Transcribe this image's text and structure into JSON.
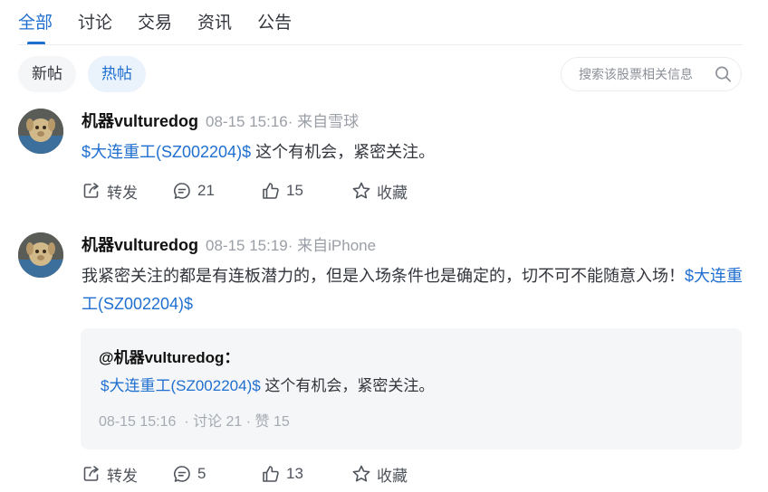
{
  "tabs": [
    {
      "label": "全部"
    },
    {
      "label": "讨论"
    },
    {
      "label": "交易"
    },
    {
      "label": "资讯"
    },
    {
      "label": "公告"
    }
  ],
  "filters": {
    "new": "新帖",
    "hot": "热帖"
  },
  "search": {
    "placeholder": "搜索该股票相关信息",
    "icon": "search-icon"
  },
  "colors": {
    "accent": "#1f6fd0",
    "muted": "#9a9ea6",
    "quote_bg": "#f5f6f7"
  },
  "action_labels": {
    "repost": "转发",
    "favorite": "收藏"
  },
  "posts": [
    {
      "author": "机器vulturedog",
      "time": "08-15 15:16",
      "source": "· 来自雪球",
      "stock": "$大连重工(SZ002204)$",
      "text": " 这个有机会，紧密关注。",
      "comments": "21",
      "likes": "15"
    },
    {
      "author": "机器vulturedog",
      "time": "08-15 15:19",
      "source": "· 来自iPhone",
      "text": "我紧密关注的都是有连板潜力的，但是入场条件也是确定的，切不可不能随意入场！",
      "stock": "$大连重工(SZ002204)$",
      "comments": "5",
      "likes": "13",
      "quote": {
        "author": "@机器vulturedog",
        "colon": "：",
        "stock": "$大连重工(SZ002204)$",
        "text": " 这个有机会，紧密关注。",
        "time": "08-15 15:16",
        "stats": "· 讨论 21 · 赞 15"
      }
    }
  ]
}
